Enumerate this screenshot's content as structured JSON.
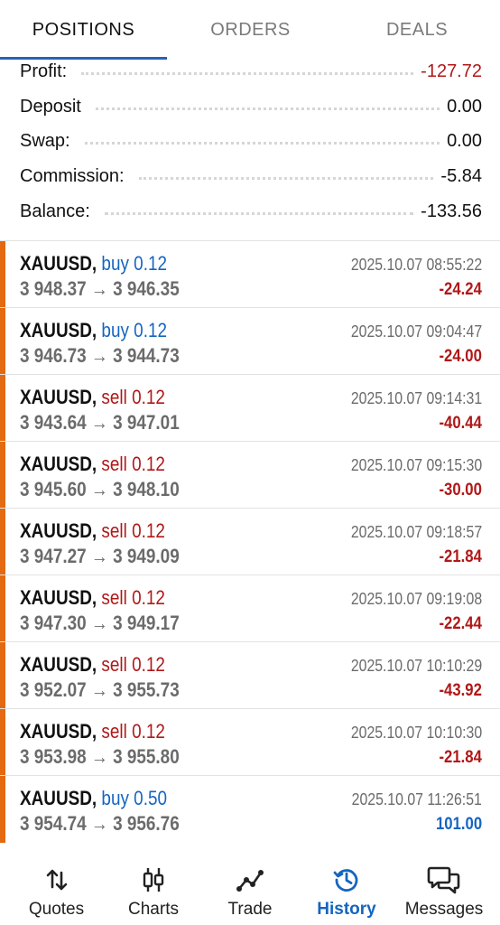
{
  "tabs": [
    {
      "label": "POSITIONS",
      "active": true
    },
    {
      "label": "ORDERS",
      "active": false
    },
    {
      "label": "DEALS",
      "active": false
    }
  ],
  "summary": [
    {
      "label": "Profit:",
      "value": "-127.72",
      "negative": true
    },
    {
      "label": "Deposit",
      "value": "0.00",
      "negative": false
    },
    {
      "label": "Swap:",
      "value": "0.00",
      "negative": false
    },
    {
      "label": "Commission:",
      "value": "-5.84",
      "negative": false
    },
    {
      "label": "Balance:",
      "value": "-133.56",
      "negative": false
    }
  ],
  "trades": [
    {
      "symbol": "XAUUSD,",
      "side": "buy 0.12",
      "type": "buy",
      "prices": "3 948.37 → 3 946.35",
      "time": "2025.10.07 08:55:22",
      "profit": "-24.24"
    },
    {
      "symbol": "XAUUSD,",
      "side": "buy 0.12",
      "type": "buy",
      "prices": "3 946.73 → 3 944.73",
      "time": "2025.10.07 09:04:47",
      "profit": "-24.00"
    },
    {
      "symbol": "XAUUSD,",
      "side": "sell 0.12",
      "type": "sell",
      "prices": "3 943.64 → 3 947.01",
      "time": "2025.10.07 09:14:31",
      "profit": "-40.44"
    },
    {
      "symbol": "XAUUSD,",
      "side": "sell 0.12",
      "type": "sell",
      "prices": "3 945.60 → 3 948.10",
      "time": "2025.10.07 09:15:30",
      "profit": "-30.00"
    },
    {
      "symbol": "XAUUSD,",
      "side": "sell 0.12",
      "type": "sell",
      "prices": "3 947.27 → 3 949.09",
      "time": "2025.10.07 09:18:57",
      "profit": "-21.84"
    },
    {
      "symbol": "XAUUSD,",
      "side": "sell 0.12",
      "type": "sell",
      "prices": "3 947.30 → 3 949.17",
      "time": "2025.10.07 09:19:08",
      "profit": "-22.44"
    },
    {
      "symbol": "XAUUSD,",
      "side": "sell 0.12",
      "type": "sell",
      "prices": "3 952.07 → 3 955.73",
      "time": "2025.10.07 10:10:29",
      "profit": "-43.92"
    },
    {
      "symbol": "XAUUSD,",
      "side": "sell 0.12",
      "type": "sell",
      "prices": "3 953.98 → 3 955.80",
      "time": "2025.10.07 10:10:30",
      "profit": "-21.84"
    },
    {
      "symbol": "XAUUSD,",
      "side": "buy 0.50",
      "type": "buy",
      "prices": "3 954.74 → 3 956.76",
      "time": "2025.10.07 11:26:51",
      "profit": "101.00"
    }
  ],
  "nav": [
    {
      "label": "Quotes",
      "icon": "quotes-icon",
      "active": false
    },
    {
      "label": "Charts",
      "icon": "charts-icon",
      "active": false
    },
    {
      "label": "Trade",
      "icon": "trade-icon",
      "active": false
    },
    {
      "label": "History",
      "icon": "history-icon",
      "active": true
    },
    {
      "label": "Messages",
      "icon": "messages-icon",
      "active": false
    }
  ],
  "colors": {
    "accent": "#1565c0",
    "negative": "#b01818",
    "position_bar": "#e36a10",
    "tab_underline": "#2962b8"
  }
}
